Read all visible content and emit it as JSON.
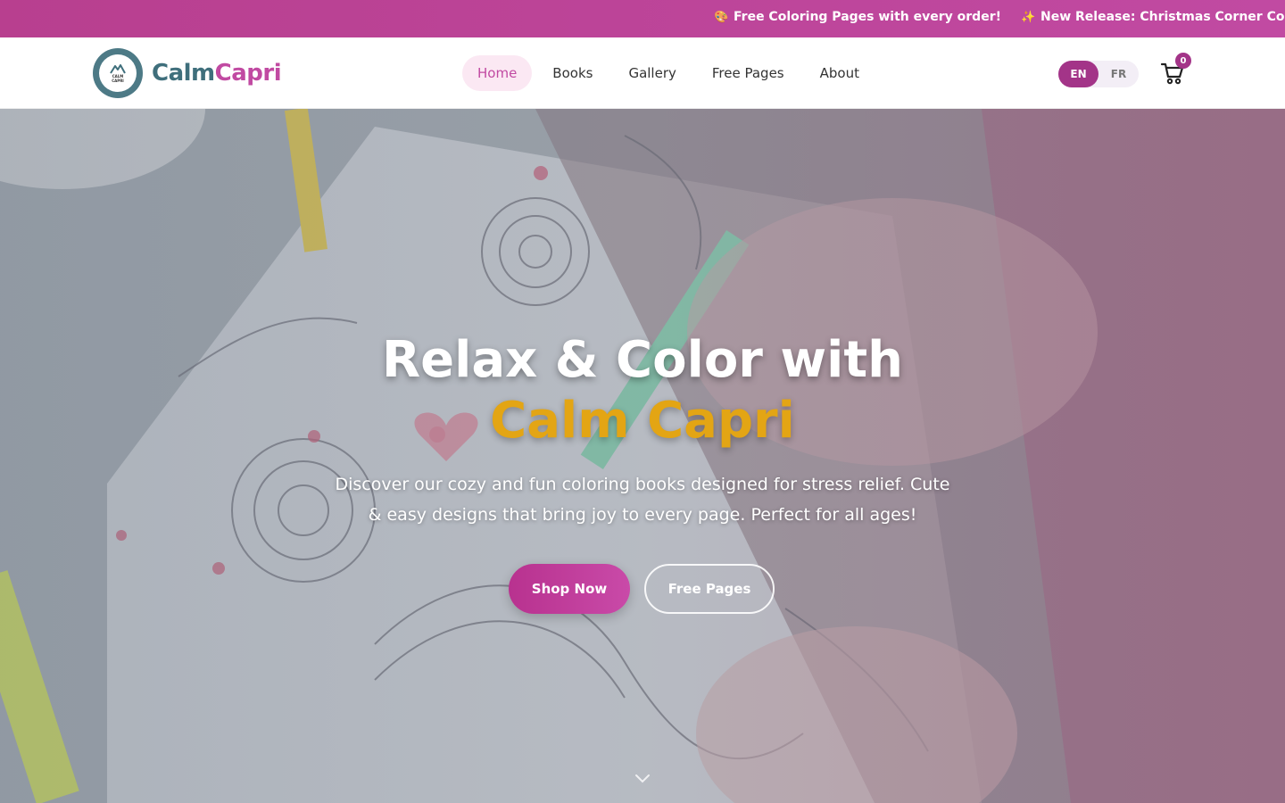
{
  "announcement": {
    "items": [
      {
        "icon": "🎨",
        "text": "Free Coloring Pages with every order!"
      },
      {
        "icon": "✨",
        "text": "New Release: Christmas Corner Coloring B"
      }
    ]
  },
  "brand": {
    "name_part1": "Calm",
    "name_part2": "Capri",
    "badge_line1": "CALM",
    "badge_line2": "CAPRI"
  },
  "nav": {
    "items": [
      {
        "label": "Home",
        "active": true
      },
      {
        "label": "Books"
      },
      {
        "label": "Gallery"
      },
      {
        "label": "Free Pages"
      },
      {
        "label": "About"
      }
    ]
  },
  "language": {
    "options": [
      "EN",
      "FR"
    ],
    "selected": "EN"
  },
  "cart": {
    "count": "0"
  },
  "hero": {
    "title_line1": "Relax & Color with",
    "title_line2": "Calm Capri",
    "subtitle": "Discover our cozy and fun coloring books designed for stress relief. Cute & easy designs that bring joy to every page. Perfect for all ages!",
    "primary_button": "Shop Now",
    "secondary_button": "Free Pages"
  },
  "colors": {
    "accent": "#c14aa2",
    "brand_teal": "#3f6f7c",
    "highlight": "#e3a514"
  }
}
